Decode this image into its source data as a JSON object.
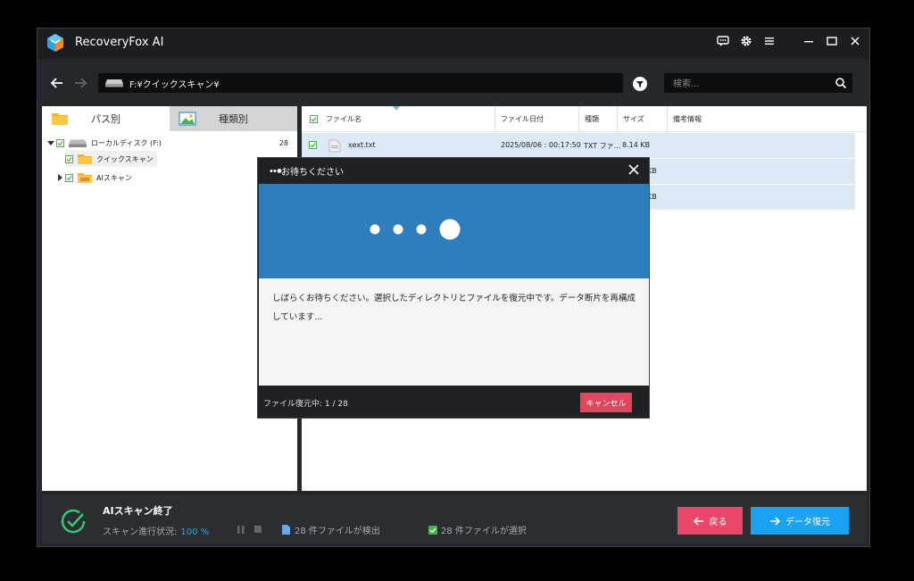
{
  "app": {
    "title": "RecoveryFox AI"
  },
  "nav": {
    "path": "F:¥クイックスキャン¥",
    "search_placeholder": "検索..."
  },
  "left_tabs": [
    {
      "label": "パス別"
    },
    {
      "label": "種類別"
    }
  ],
  "tree": {
    "root": {
      "label": "ローカルディスク (F:)",
      "count": "28"
    },
    "children": [
      {
        "label": "クイックスキャン"
      },
      {
        "label": "AIスキャン"
      }
    ]
  },
  "table": {
    "headers": {
      "name": "ファイル名",
      "date": "ファイル日付",
      "type": "種類",
      "size": "サイズ",
      "note": "備考情報"
    },
    "rows": [
      {
        "name": "xext.txt",
        "date": "2025/08/06 : 00:17:50",
        "type": "TXT ファ…",
        "size": "8.14 KB"
      },
      {
        "size_tail": "KB"
      },
      {
        "size_tail": "KB"
      }
    ]
  },
  "modal": {
    "title": "お待ちください",
    "message": "しばらくお待ちください。選択したディレクトリとファイルを復元中です。データ断片を再構成しています...",
    "progress_text": "ファイル復元中: 1 / 28",
    "cancel_label": "キャンセル"
  },
  "bottom": {
    "scan_title": "AIスキャン終了",
    "status_label": "スキャン進行状況:",
    "status_pct": "100 %",
    "found_text": "28 件ファイルが検出",
    "selected_text": "28 件ファイルが選択",
    "back_label": "戻る",
    "recover_label": "データ復元"
  }
}
